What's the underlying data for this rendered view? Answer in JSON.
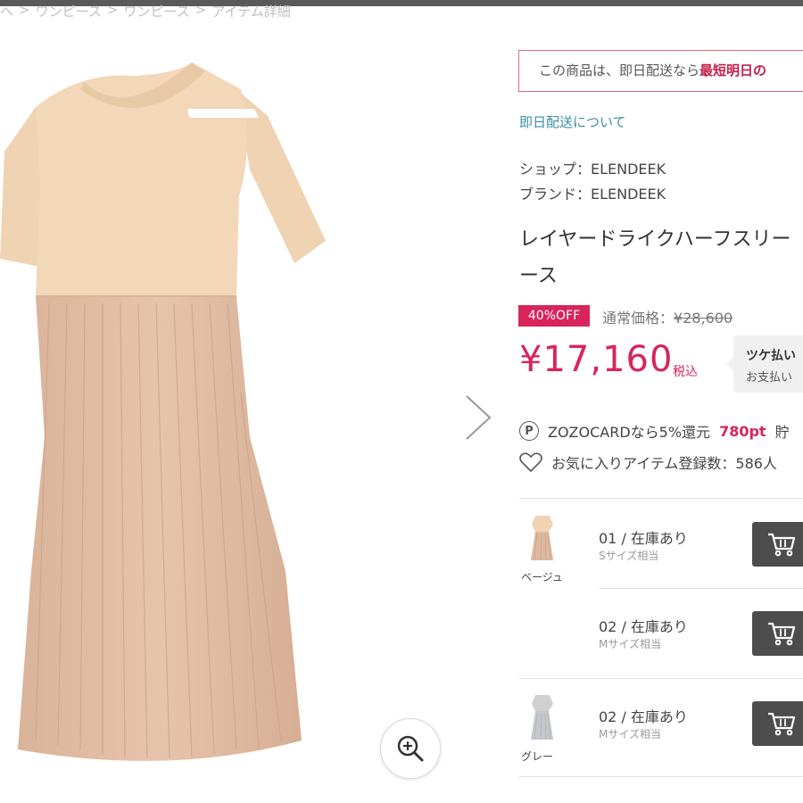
{
  "breadcrumb": [
    "ヘ",
    "ワンピース",
    "ワンピース",
    "アイテム詳細"
  ],
  "notice": {
    "prefix": "この商品は、即日配送なら",
    "emphasis": "最短明日の"
  },
  "delivery_link": "即日配送について",
  "shop_line": "ショップ：ELENDEEK",
  "brand_line": "ブランド：ELENDEEK",
  "title_lines": [
    "レイヤードライクハーフスリー",
    "ース"
  ],
  "discount_badge": "40%OFF",
  "normal_price_label": "通常価格：",
  "normal_price_value": "¥28,600",
  "price": "¥17,160",
  "tax_label": "税込",
  "tsuke": {
    "title": "ツケ払い",
    "sub": "お支払い"
  },
  "zozocard": {
    "icon_letter": "P",
    "text": "ZOZOCARDなら5%還元",
    "points": "780pt",
    "trail": "貯"
  },
  "favorites": {
    "text": "お気に入りアイテム登録数：586人"
  },
  "variants": [
    {
      "color": "ベージュ",
      "stock": "01 / 在庫あり",
      "size": "Sサイズ相当",
      "thumb": "beige"
    },
    {
      "color": "",
      "stock": "02 / 在庫あり",
      "size": "Mサイズ相当",
      "thumb": "none"
    },
    {
      "color": "グレー",
      "stock": "02 / 在庫あり",
      "size": "Mサイズ相当",
      "thumb": "gray"
    }
  ],
  "colors": {
    "accent": "#d8245a",
    "link": "#3b8ea2",
    "dress_top": "#f2d7b9",
    "dress_skirt": "#e0bda4",
    "cart_button": "#4d4d4d"
  },
  "icons": {
    "zoom": "zoom-in-icon",
    "next": "chevron-right-icon",
    "heart": "heart-outline-icon",
    "cart": "cart-icon",
    "points": "point-circle-icon"
  }
}
